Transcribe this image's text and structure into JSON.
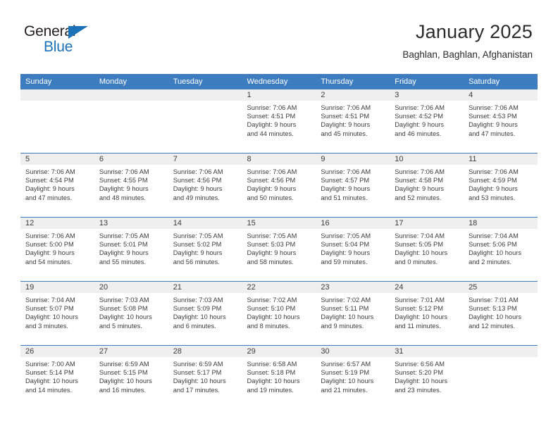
{
  "brand": {
    "line1": "General",
    "line2": "Blue",
    "accent_color": "#1b72b8"
  },
  "header": {
    "title": "January 2025",
    "location": "Baghlan, Baghlan, Afghanistan"
  },
  "theme": {
    "header_bg": "#3d7cbf",
    "daynum_bg": "#efefef",
    "text": "#3c3c3c"
  },
  "weekdays": [
    "Sunday",
    "Monday",
    "Tuesday",
    "Wednesday",
    "Thursday",
    "Friday",
    "Saturday"
  ],
  "weeks": [
    [
      {
        "day": "",
        "sunrise": "",
        "sunset": "",
        "daylight_line1": "",
        "daylight_line2": "",
        "empty": true
      },
      {
        "day": "",
        "sunrise": "",
        "sunset": "",
        "daylight_line1": "",
        "daylight_line2": "",
        "empty": true
      },
      {
        "day": "",
        "sunrise": "",
        "sunset": "",
        "daylight_line1": "",
        "daylight_line2": "",
        "empty": true
      },
      {
        "day": "1",
        "sunrise": "Sunrise: 7:06 AM",
        "sunset": "Sunset: 4:51 PM",
        "daylight_line1": "Daylight: 9 hours",
        "daylight_line2": "and 44 minutes."
      },
      {
        "day": "2",
        "sunrise": "Sunrise: 7:06 AM",
        "sunset": "Sunset: 4:51 PM",
        "daylight_line1": "Daylight: 9 hours",
        "daylight_line2": "and 45 minutes."
      },
      {
        "day": "3",
        "sunrise": "Sunrise: 7:06 AM",
        "sunset": "Sunset: 4:52 PM",
        "daylight_line1": "Daylight: 9 hours",
        "daylight_line2": "and 46 minutes."
      },
      {
        "day": "4",
        "sunrise": "Sunrise: 7:06 AM",
        "sunset": "Sunset: 4:53 PM",
        "daylight_line1": "Daylight: 9 hours",
        "daylight_line2": "and 47 minutes."
      }
    ],
    [
      {
        "day": "5",
        "sunrise": "Sunrise: 7:06 AM",
        "sunset": "Sunset: 4:54 PM",
        "daylight_line1": "Daylight: 9 hours",
        "daylight_line2": "and 47 minutes."
      },
      {
        "day": "6",
        "sunrise": "Sunrise: 7:06 AM",
        "sunset": "Sunset: 4:55 PM",
        "daylight_line1": "Daylight: 9 hours",
        "daylight_line2": "and 48 minutes."
      },
      {
        "day": "7",
        "sunrise": "Sunrise: 7:06 AM",
        "sunset": "Sunset: 4:56 PM",
        "daylight_line1": "Daylight: 9 hours",
        "daylight_line2": "and 49 minutes."
      },
      {
        "day": "8",
        "sunrise": "Sunrise: 7:06 AM",
        "sunset": "Sunset: 4:56 PM",
        "daylight_line1": "Daylight: 9 hours",
        "daylight_line2": "and 50 minutes."
      },
      {
        "day": "9",
        "sunrise": "Sunrise: 7:06 AM",
        "sunset": "Sunset: 4:57 PM",
        "daylight_line1": "Daylight: 9 hours",
        "daylight_line2": "and 51 minutes."
      },
      {
        "day": "10",
        "sunrise": "Sunrise: 7:06 AM",
        "sunset": "Sunset: 4:58 PM",
        "daylight_line1": "Daylight: 9 hours",
        "daylight_line2": "and 52 minutes."
      },
      {
        "day": "11",
        "sunrise": "Sunrise: 7:06 AM",
        "sunset": "Sunset: 4:59 PM",
        "daylight_line1": "Daylight: 9 hours",
        "daylight_line2": "and 53 minutes."
      }
    ],
    [
      {
        "day": "12",
        "sunrise": "Sunrise: 7:06 AM",
        "sunset": "Sunset: 5:00 PM",
        "daylight_line1": "Daylight: 9 hours",
        "daylight_line2": "and 54 minutes."
      },
      {
        "day": "13",
        "sunrise": "Sunrise: 7:05 AM",
        "sunset": "Sunset: 5:01 PM",
        "daylight_line1": "Daylight: 9 hours",
        "daylight_line2": "and 55 minutes."
      },
      {
        "day": "14",
        "sunrise": "Sunrise: 7:05 AM",
        "sunset": "Sunset: 5:02 PM",
        "daylight_line1": "Daylight: 9 hours",
        "daylight_line2": "and 56 minutes."
      },
      {
        "day": "15",
        "sunrise": "Sunrise: 7:05 AM",
        "sunset": "Sunset: 5:03 PM",
        "daylight_line1": "Daylight: 9 hours",
        "daylight_line2": "and 58 minutes."
      },
      {
        "day": "16",
        "sunrise": "Sunrise: 7:05 AM",
        "sunset": "Sunset: 5:04 PM",
        "daylight_line1": "Daylight: 9 hours",
        "daylight_line2": "and 59 minutes."
      },
      {
        "day": "17",
        "sunrise": "Sunrise: 7:04 AM",
        "sunset": "Sunset: 5:05 PM",
        "daylight_line1": "Daylight: 10 hours",
        "daylight_line2": "and 0 minutes."
      },
      {
        "day": "18",
        "sunrise": "Sunrise: 7:04 AM",
        "sunset": "Sunset: 5:06 PM",
        "daylight_line1": "Daylight: 10 hours",
        "daylight_line2": "and 2 minutes."
      }
    ],
    [
      {
        "day": "19",
        "sunrise": "Sunrise: 7:04 AM",
        "sunset": "Sunset: 5:07 PM",
        "daylight_line1": "Daylight: 10 hours",
        "daylight_line2": "and 3 minutes."
      },
      {
        "day": "20",
        "sunrise": "Sunrise: 7:03 AM",
        "sunset": "Sunset: 5:08 PM",
        "daylight_line1": "Daylight: 10 hours",
        "daylight_line2": "and 5 minutes."
      },
      {
        "day": "21",
        "sunrise": "Sunrise: 7:03 AM",
        "sunset": "Sunset: 5:09 PM",
        "daylight_line1": "Daylight: 10 hours",
        "daylight_line2": "and 6 minutes."
      },
      {
        "day": "22",
        "sunrise": "Sunrise: 7:02 AM",
        "sunset": "Sunset: 5:10 PM",
        "daylight_line1": "Daylight: 10 hours",
        "daylight_line2": "and 8 minutes."
      },
      {
        "day": "23",
        "sunrise": "Sunrise: 7:02 AM",
        "sunset": "Sunset: 5:11 PM",
        "daylight_line1": "Daylight: 10 hours",
        "daylight_line2": "and 9 minutes."
      },
      {
        "day": "24",
        "sunrise": "Sunrise: 7:01 AM",
        "sunset": "Sunset: 5:12 PM",
        "daylight_line1": "Daylight: 10 hours",
        "daylight_line2": "and 11 minutes."
      },
      {
        "day": "25",
        "sunrise": "Sunrise: 7:01 AM",
        "sunset": "Sunset: 5:13 PM",
        "daylight_line1": "Daylight: 10 hours",
        "daylight_line2": "and 12 minutes."
      }
    ],
    [
      {
        "day": "26",
        "sunrise": "Sunrise: 7:00 AM",
        "sunset": "Sunset: 5:14 PM",
        "daylight_line1": "Daylight: 10 hours",
        "daylight_line2": "and 14 minutes."
      },
      {
        "day": "27",
        "sunrise": "Sunrise: 6:59 AM",
        "sunset": "Sunset: 5:15 PM",
        "daylight_line1": "Daylight: 10 hours",
        "daylight_line2": "and 16 minutes."
      },
      {
        "day": "28",
        "sunrise": "Sunrise: 6:59 AM",
        "sunset": "Sunset: 5:17 PM",
        "daylight_line1": "Daylight: 10 hours",
        "daylight_line2": "and 17 minutes."
      },
      {
        "day": "29",
        "sunrise": "Sunrise: 6:58 AM",
        "sunset": "Sunset: 5:18 PM",
        "daylight_line1": "Daylight: 10 hours",
        "daylight_line2": "and 19 minutes."
      },
      {
        "day": "30",
        "sunrise": "Sunrise: 6:57 AM",
        "sunset": "Sunset: 5:19 PM",
        "daylight_line1": "Daylight: 10 hours",
        "daylight_line2": "and 21 minutes."
      },
      {
        "day": "31",
        "sunrise": "Sunrise: 6:56 AM",
        "sunset": "Sunset: 5:20 PM",
        "daylight_line1": "Daylight: 10 hours",
        "daylight_line2": "and 23 minutes."
      },
      {
        "day": "",
        "sunrise": "",
        "sunset": "",
        "daylight_line1": "",
        "daylight_line2": "",
        "empty": true
      }
    ]
  ]
}
